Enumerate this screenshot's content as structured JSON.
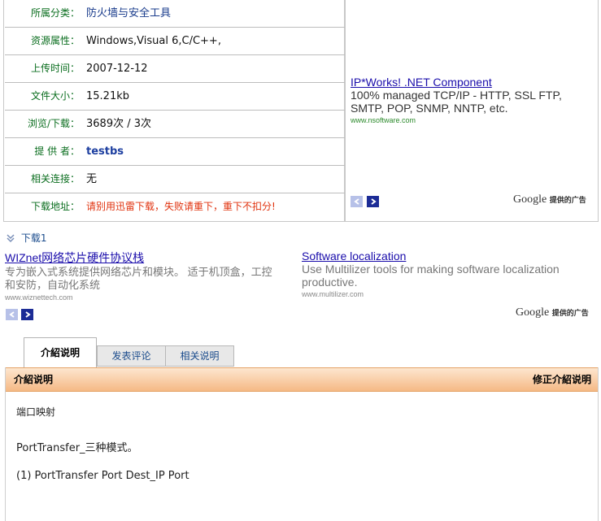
{
  "info": {
    "rows": [
      {
        "label": "所属分类：",
        "value": "防火墙与安全工具"
      },
      {
        "label": "资源属性：",
        "value": "Windows,Visual 6,C/C++,"
      },
      {
        "label": "上传时间：",
        "value": "2007-12-12"
      },
      {
        "label": "文件大小：",
        "value": "15.21kb"
      },
      {
        "label": "浏览/下载：",
        "value": "3689次 / 3次"
      },
      {
        "label": "提 供 者：",
        "value": "testbs"
      },
      {
        "label": "相关连接：",
        "value": "无"
      },
      {
        "label": "下载地址：",
        "value": "请别用迅雷下载，失败请重下，重下不扣分!"
      }
    ]
  },
  "ad_right": {
    "title": "IP*Works! .NET Component",
    "desc_line1": "100% managed TCP/IP - HTTP, SSL FTP,",
    "desc_line2": "SMTP, POP, SNMP, NNTP, etc.",
    "url": "www.nsoftware.com",
    "google_label": "Google",
    "google_sub": "提供的广告"
  },
  "download": {
    "label": "下载1"
  },
  "ads_bottom": [
    {
      "title": "WIZnet网络芯片硬件协议栈",
      "desc_line1": "专为嵌入式系统提供网络芯片和模块。 适于机顶盒，工控",
      "desc_line2": "和安防，自动化系统",
      "url": "www.wiznettech.com"
    },
    {
      "title": "Software localization",
      "desc_line1": "Use Multilizer tools for making software localization",
      "desc_line2": "productive.",
      "url": "www.multilizer.com"
    }
  ],
  "ads_bottom_google": {
    "label": "Google",
    "sub": "提供的广告"
  },
  "tabs": [
    {
      "label": "介紹说明"
    },
    {
      "label": "发表评论"
    },
    {
      "label": "相关说明"
    }
  ],
  "content": {
    "bar_title": "介紹说明",
    "bar_action": "修正介紹说明",
    "lines": [
      "端口映射",
      "PortTransfer_三种模式。",
      "(1) PortTransfer Port Dest_IP Port"
    ]
  },
  "colors": {
    "label_green": "#0b6e1f",
    "link_blue": "#1a0dab",
    "warning_red": "#e0320e",
    "bar_orange": "#f5b985"
  }
}
